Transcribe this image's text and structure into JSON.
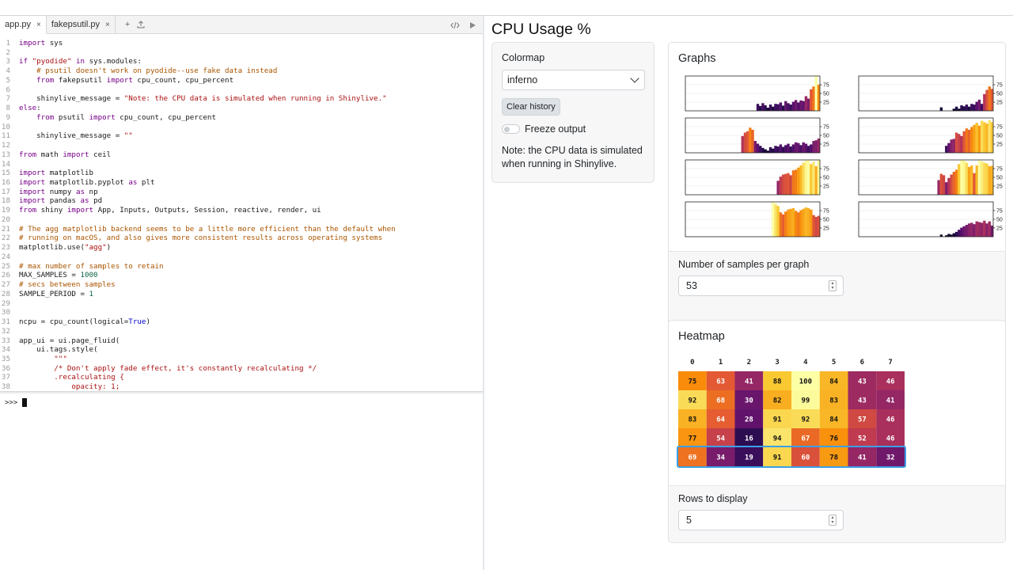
{
  "editor": {
    "tabs": [
      {
        "label": "app.py",
        "active": true
      },
      {
        "label": "fakepsutil.py",
        "active": false
      }
    ],
    "tab_close_label": "×",
    "tab_add_label": "+",
    "lines": [
      {
        "n": "1",
        "html": "<span class=\"k\">import</span> sys"
      },
      {
        "n": "2",
        "html": ""
      },
      {
        "n": "3",
        "html": "<span class=\"k\">if</span> <span class=\"s\">\"pyodide\"</span> <span class=\"k\">in</span> sys.modules:"
      },
      {
        "n": "4",
        "html": "    <span class=\"c\"># psutil doesn't work on pyodide--use fake data instead</span>"
      },
      {
        "n": "5",
        "html": "    <span class=\"k\">from</span> fakepsutil <span class=\"k\">import</span> cpu_count, cpu_percent"
      },
      {
        "n": "6",
        "html": ""
      },
      {
        "n": "7",
        "html": "    shinylive_message = <span class=\"s\">\"Note: the CPU data is simulated when running in Shinylive.\"</span>"
      },
      {
        "n": "8",
        "html": "<span class=\"k\">else</span>:"
      },
      {
        "n": "9",
        "html": "    <span class=\"k\">from</span> psutil <span class=\"k\">import</span> cpu_count, cpu_percent"
      },
      {
        "n": "10",
        "html": ""
      },
      {
        "n": "11",
        "html": "    shinylive_message = <span class=\"s\">\"\"</span>"
      },
      {
        "n": "12",
        "html": ""
      },
      {
        "n": "13",
        "html": "<span class=\"k\">from</span> math <span class=\"k\">import</span> ceil"
      },
      {
        "n": "14",
        "html": ""
      },
      {
        "n": "15",
        "html": "<span class=\"k\">import</span> matplotlib"
      },
      {
        "n": "16",
        "html": "<span class=\"k\">import</span> matplotlib.pyplot <span class=\"k\">as</span> plt"
      },
      {
        "n": "17",
        "html": "<span class=\"k\">import</span> numpy <span class=\"k\">as</span> np"
      },
      {
        "n": "18",
        "html": "<span class=\"k\">import</span> pandas <span class=\"k\">as</span> pd"
      },
      {
        "n": "19",
        "html": "<span class=\"k\">from</span> shiny <span class=\"k\">import</span> App, Inputs, Outputs, Session, reactive, render, ui"
      },
      {
        "n": "20",
        "html": ""
      },
      {
        "n": "21",
        "html": "<span class=\"c\"># The agg matplotlib backend seems to be a little more efficient than the default when</span>"
      },
      {
        "n": "22",
        "html": "<span class=\"c\"># running on macOS, and also gives more consistent results across operating systems</span>"
      },
      {
        "n": "23",
        "html": "matplotlib.use(<span class=\"s\">\"agg\"</span>)"
      },
      {
        "n": "24",
        "html": ""
      },
      {
        "n": "25",
        "html": "<span class=\"c\"># max number of samples to retain</span>"
      },
      {
        "n": "26",
        "html": "MAX_SAMPLES = <span class=\"n\">1000</span>"
      },
      {
        "n": "27",
        "html": "<span class=\"c\"># secs between samples</span>"
      },
      {
        "n": "28",
        "html": "SAMPLE_PERIOD = <span class=\"n\">1</span>"
      },
      {
        "n": "29",
        "html": ""
      },
      {
        "n": "30",
        "html": ""
      },
      {
        "n": "31",
        "html": "ncpu = cpu_count(logical=<span class=\"b\">True</span>)"
      },
      {
        "n": "32",
        "html": ""
      },
      {
        "n": "33",
        "html": "app_ui = ui.page_fluid("
      },
      {
        "n": "34",
        "html": "    ui.tags.style("
      },
      {
        "n": "35",
        "html": "        <span class=\"s\">\"\"\"</span>"
      },
      {
        "n": "36",
        "html": "        <span class=\"s\">/* Don't apply fade effect, it's constantly recalculating */</span>"
      },
      {
        "n": "37",
        "html": "        <span class=\"s\">.recalculating {</span>"
      },
      {
        "n": "38",
        "html": "            <span class=\"s\">opacity: 1;</span>"
      }
    ],
    "console_prompt": ">>>"
  },
  "app": {
    "title": "CPU Usage %",
    "sidebar": {
      "colormap_label": "Colormap",
      "colormap_value": "inferno",
      "clear_button": "Clear history",
      "freeze_label": "Freeze output",
      "freeze_on": false,
      "note": "Note: the CPU data is simulated when running in Shinylive."
    },
    "graphs": {
      "title": "Graphs",
      "samples_label": "Number of samples per graph",
      "samples_value": "53",
      "y_ticks": [
        "75",
        "50",
        "25"
      ],
      "chart_data": {
        "type": "bar",
        "title": "",
        "ylim": [
          0,
          100
        ],
        "grid": true,
        "series": [
          {
            "cpu": 0,
            "values": [
              0,
              0,
              0,
              0,
              0,
              0,
              0,
              0,
              0,
              0,
              0,
              0,
              0,
              0,
              0,
              0,
              0,
              0,
              0,
              0,
              0,
              0,
              0,
              0,
              0,
              0,
              0,
              0,
              20,
              14,
              22,
              16,
              9,
              18,
              12,
              20,
              19,
              24,
              15,
              28,
              22,
              18,
              26,
              31,
              24,
              30,
              28,
              42,
              35,
              62,
              70,
              100,
              75
            ]
          },
          {
            "cpu": 1,
            "values": [
              0,
              0,
              0,
              0,
              0,
              0,
              0,
              0,
              0,
              0,
              0,
              0,
              0,
              0,
              0,
              0,
              0,
              0,
              0,
              0,
              0,
              0,
              0,
              0,
              0,
              0,
              0,
              0,
              0,
              0,
              0,
              0,
              10,
              0,
              0,
              0,
              0,
              6,
              12,
              6,
              16,
              13,
              18,
              12,
              20,
              18,
              26,
              32,
              20,
              48,
              60,
              70,
              63
            ]
          },
          {
            "cpu": 2,
            "values": [
              0,
              0,
              0,
              0,
              0,
              0,
              0,
              0,
              0,
              0,
              0,
              0,
              0,
              0,
              0,
              0,
              0,
              0,
              0,
              0,
              0,
              0,
              0,
              0,
              0,
              0,
              0,
              0,
              0,
              0,
              0,
              0,
              0,
              0,
              0,
              0,
              0,
              0,
              0,
              0,
              0,
              0,
              0,
              0,
              0,
              0,
              0,
              0,
              0,
              0,
              0,
              0,
              0,
              0,
              0,
              0,
              0,
              0,
              48,
              58,
              62,
              72,
              66,
              34,
              26,
              20,
              14,
              10,
              6,
              16,
              12,
              20,
              18,
              24,
              17,
              22,
              26,
              18,
              24,
              30,
              28,
              22,
              30,
              26,
              20,
              24,
              34,
              36,
              41
            ]
          },
          {
            "cpu": 3,
            "values": [
              0,
              0,
              0,
              0,
              0,
              0,
              0,
              0,
              0,
              0,
              0,
              0,
              0,
              0,
              0,
              0,
              0,
              0,
              0,
              0,
              0,
              0,
              0,
              0,
              0,
              0,
              0,
              0,
              0,
              0,
              0,
              0,
              0,
              0,
              20,
              28,
              38,
              40,
              58,
              54,
              48,
              62,
              70,
              66,
              74,
              80,
              86,
              78,
              92,
              88,
              84,
              94,
              88
            ]
          },
          {
            "cpu": 4,
            "values": [
              0,
              0,
              0,
              0,
              0,
              0,
              0,
              0,
              0,
              0,
              0,
              0,
              0,
              0,
              0,
              0,
              0,
              0,
              0,
              0,
              0,
              0,
              0,
              0,
              0,
              0,
              0,
              0,
              0,
              0,
              0,
              0,
              0,
              0,
              0,
              0,
              40,
              52,
              58,
              60,
              62,
              56,
              70,
              72,
              78,
              84,
              92,
              98,
              100,
              88,
              95,
              82,
              99
            ]
          },
          {
            "cpu": 5,
            "values": [
              0,
              0,
              0,
              0,
              0,
              0,
              0,
              0,
              0,
              0,
              0,
              0,
              0,
              0,
              0,
              0,
              0,
              0,
              0,
              0,
              0,
              0,
              0,
              0,
              0,
              0,
              0,
              0,
              0,
              0,
              0,
              0,
              0,
              0,
              0,
              0,
              0,
              0,
              0,
              0,
              0,
              0,
              0,
              0,
              0,
              0,
              0,
              0,
              0,
              0,
              0,
              0,
              0,
              42,
              60,
              56,
              36,
              48,
              58,
              66,
              72,
              88,
              100,
              98,
              92,
              80,
              84,
              62,
              84,
              100,
              96,
              92,
              90,
              82,
              83
            ]
          },
          {
            "cpu": 6,
            "values": [
              0,
              0,
              0,
              0,
              0,
              0,
              0,
              0,
              0,
              0,
              0,
              0,
              0,
              0,
              0,
              0,
              0,
              0,
              0,
              0,
              0,
              0,
              0,
              0,
              0,
              0,
              0,
              0,
              0,
              0,
              0,
              0,
              0,
              0,
              100,
              94,
              88,
              70,
              64,
              72,
              78,
              80,
              82,
              74,
              70,
              76,
              80,
              84,
              82,
              78,
              62,
              57,
              60
            ]
          },
          {
            "cpu": 7,
            "values": [
              0,
              0,
              0,
              0,
              0,
              0,
              0,
              0,
              0,
              0,
              0,
              0,
              0,
              0,
              0,
              0,
              0,
              0,
              0,
              0,
              0,
              0,
              0,
              0,
              0,
              0,
              0,
              0,
              0,
              0,
              0,
              0,
              6,
              0,
              4,
              8,
              6,
              10,
              14,
              20,
              26,
              30,
              34,
              38,
              40,
              36,
              44,
              42,
              40,
              46,
              38,
              44,
              32
            ]
          }
        ]
      }
    },
    "heatmap": {
      "title": "Heatmap",
      "rows_label": "Rows to display",
      "rows_value": "5",
      "chart_data": {
        "type": "heatmap",
        "columns": [
          "0",
          "1",
          "2",
          "3",
          "4",
          "5",
          "6",
          "7"
        ],
        "rows": [
          [
            75,
            63,
            41,
            88,
            100,
            84,
            43,
            46
          ],
          [
            92,
            68,
            30,
            82,
            99,
            83,
            43,
            41
          ],
          [
            83,
            64,
            28,
            91,
            92,
            84,
            57,
            46
          ],
          [
            77,
            54,
            16,
            94,
            67,
            76,
            52,
            46
          ],
          [
            69,
            34,
            19,
            91,
            60,
            78,
            41,
            32
          ]
        ],
        "highlighted_row": 4,
        "highlight_color": "#3aa0e8"
      }
    }
  }
}
